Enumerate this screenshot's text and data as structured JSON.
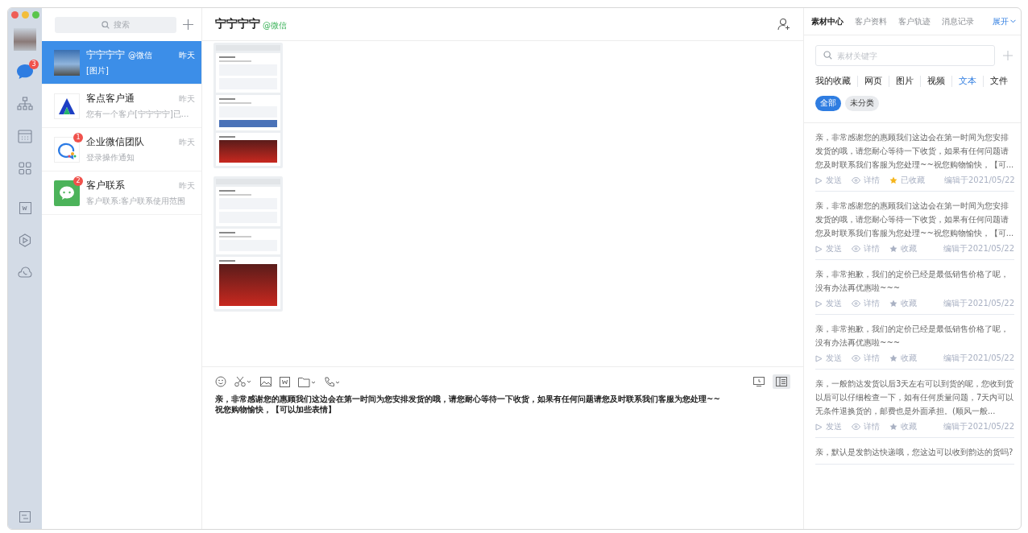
{
  "rail": {
    "items": [
      {
        "kind": "chat",
        "selected": true,
        "badge": "3"
      },
      {
        "kind": "org",
        "selected": false
      },
      {
        "kind": "calendar",
        "selected": false
      },
      {
        "kind": "apps",
        "selected": false
      },
      {
        "kind": "doc",
        "selected": false
      },
      {
        "kind": "hexagon",
        "selected": false
      },
      {
        "kind": "cloud",
        "selected": false
      }
    ]
  },
  "search": {
    "placeholder": "搜索"
  },
  "conversations": [
    {
      "kind": "photo",
      "name": "宁宁宁宁",
      "tag": "@微信",
      "time": "昨天",
      "preview": "[图片]",
      "selected": true
    },
    {
      "kind": "logo",
      "name": "客点客户通",
      "time": "昨天",
      "preview": "您有一个客户[宁宁宁宁]已...",
      "selected": false
    },
    {
      "kind": "bubbles",
      "name": "企业微信团队",
      "time": "昨天",
      "preview": "登录操作通知",
      "badge": "1",
      "selected": false
    },
    {
      "kind": "wechat",
      "name": "客户联系",
      "time": "昨天",
      "preview": "客户联系:客户联系使用范围",
      "badge": "2",
      "selected": false
    }
  ],
  "chat": {
    "title": "宁宁宁宁",
    "tag": "@微信",
    "composer": {
      "value": "亲，非常感谢您的惠顾我们这边会在第一时间为您安排发货的哦，请您耐心等待一下收货，如果有任何问题请您及时联系我们客服为您处理~~\n祝您购物愉快，【可以加些表情】"
    }
  },
  "panel": {
    "tabs": [
      {
        "label": "素材中心",
        "selected": true
      },
      {
        "label": "客户资料",
        "selected": false
      },
      {
        "label": "客户轨迹",
        "selected": false
      },
      {
        "label": "消息记录",
        "selected": false
      }
    ],
    "expand": "展开",
    "search": {
      "placeholder": "素材关键字"
    },
    "categories": [
      {
        "label": "我的收藏",
        "selected": false
      },
      {
        "label": "网页",
        "selected": false
      },
      {
        "label": "图片",
        "selected": false
      },
      {
        "label": "视频",
        "selected": false
      },
      {
        "label": "文本",
        "selected": true
      },
      {
        "label": "文件",
        "selected": false
      }
    ],
    "chips": [
      {
        "label": "全部",
        "selected": true
      },
      {
        "label": "未分类",
        "selected": false
      }
    ],
    "items": [
      {
        "text": "亲，非常感谢您的惠顾我们这边会在第一时间为您安排发货的哦，请您耐心等待一下收货，如果有任何问题请您及时联系我们客服为您处理~~祝您购物愉快，【可...",
        "send": "发送",
        "detail": "详情",
        "favorite": "已收藏",
        "favorited": true,
        "edited": "编辑于2021/05/22"
      },
      {
        "text": "亲，非常感谢您的惠顾我们这边会在第一时间为您安排发货的哦，请您耐心等待一下收货，如果有任何问题请您及时联系我们客服为您处理~~祝您购物愉快，【可...",
        "send": "发送",
        "detail": "详情",
        "favorite": "收藏",
        "favorited": false,
        "edited": "编辑于2021/05/22"
      },
      {
        "text": "亲，非常抱歉，我们的定价已经是最低销售价格了呢，没有办法再优惠啦~~~",
        "send": "发送",
        "detail": "详情",
        "favorite": "收藏",
        "favorited": false,
        "edited": "编辑于2021/05/22"
      },
      {
        "text": "亲，非常抱歉，我们的定价已经是最低销售价格了呢，没有办法再优惠啦~~~",
        "send": "发送",
        "detail": "详情",
        "favorite": "收藏",
        "favorited": false,
        "edited": "编辑于2021/05/22"
      },
      {
        "text": "亲，一般韵达发货以后3天左右可以到货的呢，您收到货以后可以仔细检查一下，如有任何质量问题，7天内可以无条件退换货的，邮费也是外面承担。(顺风一般...",
        "send": "发送",
        "detail": "详情",
        "favorite": "收藏",
        "favorited": false,
        "edited": "编辑于2021/05/22"
      },
      {
        "text": "亲，默认是发韵达快递哦，您这边可以收到韵达的货吗?"
      }
    ]
  }
}
